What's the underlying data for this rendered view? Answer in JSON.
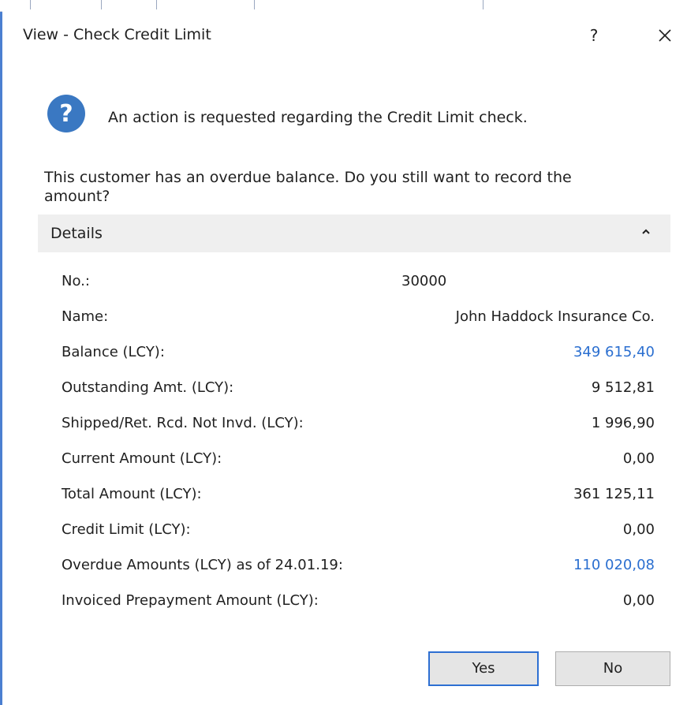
{
  "window": {
    "title": "View - Check Credit Limit",
    "help_label": "?",
    "close_icon": "close-icon"
  },
  "message": {
    "icon": "question-icon",
    "headline": "An action is requested regarding the Credit Limit check.",
    "prompt": "This customer has an overdue balance. Do you still want to record the amount?"
  },
  "details": {
    "label": "Details",
    "toggle_icon": "chevron-up-icon",
    "rows": [
      {
        "label": "No.:",
        "value": "30000",
        "link": false
      },
      {
        "label": "Name:",
        "value": "John Haddock Insurance Co.",
        "link": false
      },
      {
        "label": "Balance (LCY):",
        "value": "349 615,40",
        "link": true
      },
      {
        "label": "Outstanding Amt. (LCY):",
        "value": "9 512,81",
        "link": false
      },
      {
        "label": "Shipped/Ret. Rcd. Not Invd. (LCY):",
        "value": "1 996,90",
        "link": false
      },
      {
        "label": "Current Amount (LCY):",
        "value": "0,00",
        "link": false
      },
      {
        "label": "Total Amount (LCY):",
        "value": "361 125,11",
        "link": false
      },
      {
        "label": "Credit Limit (LCY):",
        "value": "0,00",
        "link": false
      },
      {
        "label": "Overdue Amounts (LCY) as of 24.01.19:",
        "value": "110 020,08",
        "link": true
      },
      {
        "label": "Invoiced Prepayment Amount (LCY):",
        "value": "0,00",
        "link": false
      }
    ]
  },
  "buttons": {
    "yes_label": "Yes",
    "no_label": "No"
  },
  "colors": {
    "accent": "#2d6fd2",
    "link": "#2b6fd0",
    "icon_blue": "#3a78c2",
    "details_bg": "#efefef"
  }
}
